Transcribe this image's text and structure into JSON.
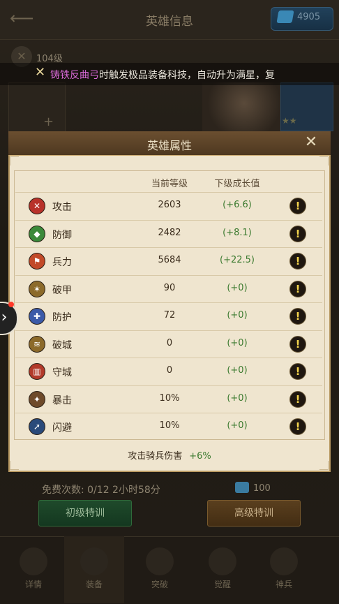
{
  "background": {
    "title": "英雄信息",
    "currency": "4905",
    "level": "104级",
    "scroll_highlight": "铸铁反曲弓",
    "scroll_text": "时触发极品装备科技，自动升为满星，复",
    "free_count": "免费次数: 0/12  2小时58分",
    "cost": "100",
    "btn_basic": "初级特训",
    "btn_advanced": "高级特训",
    "nav": [
      "详情",
      "装备",
      "突破",
      "觉醒",
      "神兵"
    ]
  },
  "modal": {
    "title": "英雄属性",
    "col_current": "当前等级",
    "col_growth": "下级成长值",
    "footer_label": "攻击骑兵伤害",
    "footer_value": "+6%",
    "stats": [
      {
        "name": "攻击",
        "current": "2603",
        "growth": "(+6.6)",
        "icon": "sword-icon",
        "color": "#b8322a"
      },
      {
        "name": "防御",
        "current": "2482",
        "growth": "(+8.1)",
        "icon": "shield-icon",
        "color": "#3b8a3a"
      },
      {
        "name": "兵力",
        "current": "5684",
        "growth": "(+22.5)",
        "icon": "flag-icon",
        "color": "#c24a28"
      },
      {
        "name": "破甲",
        "current": "90",
        "growth": "(+0)",
        "icon": "armor-break-icon",
        "color": "#8c6a2a"
      },
      {
        "name": "防护",
        "current": "72",
        "growth": "(+0)",
        "icon": "protect-icon",
        "color": "#3b5aa8"
      },
      {
        "name": "破城",
        "current": "0",
        "growth": "(+0)",
        "icon": "siege-icon",
        "color": "#8c6a2a"
      },
      {
        "name": "守城",
        "current": "0",
        "growth": "(+0)",
        "icon": "tower-icon",
        "color": "#b23a2a"
      },
      {
        "name": "暴击",
        "current": "10%",
        "growth": "(+0)",
        "icon": "crit-icon",
        "color": "#6e4a2a"
      },
      {
        "name": "闪避",
        "current": "10%",
        "growth": "(+0)",
        "icon": "dodge-icon",
        "color": "#2a4a7a"
      }
    ]
  }
}
